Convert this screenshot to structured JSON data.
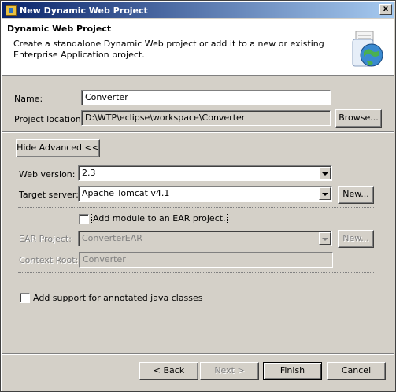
{
  "window": {
    "title": "New Dynamic Web Project",
    "close_glyph": "x"
  },
  "header": {
    "title": "Dynamic Web Project",
    "description": "Create a standalone Dynamic Web project or add it to a new or existing Enterprise Application project.",
    "icon": "web-project-globe-icon"
  },
  "form": {
    "name_label": "Name:",
    "name_value": "Converter",
    "location_label": "Project location:",
    "location_value": "D:\\WTP\\eclipse\\workspace\\Converter",
    "browse_button": "Browse...",
    "hide_advanced_button": "Hide Advanced <<",
    "web_version_label": "Web version:",
    "web_version_value": "2.3",
    "target_server_label": "Target server:",
    "target_server_value": "Apache Tomcat v4.1",
    "new_server_button": "New...",
    "add_ear_label": "Add module to an EAR project.",
    "ear_project_label": "EAR Project:",
    "ear_project_value": "ConverterEAR",
    "new_ear_button": "New...",
    "context_root_label": "Context Root:",
    "context_root_value": "Converter",
    "annotated_label": "Add support for annotated java classes"
  },
  "footer": {
    "back_button": "< Back",
    "next_button": "Next >",
    "finish_button": "Finish",
    "cancel_button": "Cancel"
  },
  "colors": {
    "title_bar_start": "#0a246a",
    "title_bar_end": "#a6caf0",
    "dialog_background": "#d4d0c8",
    "disabled_text": "#808080"
  }
}
